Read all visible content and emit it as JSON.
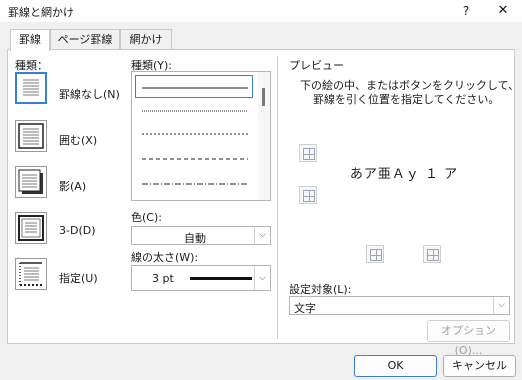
{
  "window": {
    "title": "罫線と網かけ",
    "help": "?",
    "close": "✕"
  },
  "tabs": [
    {
      "label": "罫線"
    },
    {
      "label": "ページ罫線"
    },
    {
      "label": "網かけ"
    }
  ],
  "settings": {
    "heading": "種類：",
    "items": [
      {
        "label": "罫線なし(N)"
      },
      {
        "label": "囲む(X)"
      },
      {
        "label": "影(A)"
      },
      {
        "label": "3-D(D)"
      },
      {
        "label": "指定(U)"
      }
    ]
  },
  "style": {
    "heading": "種類(Y):",
    "color_label": "色(C):",
    "color_value": "自動",
    "width_label": "線の太さ(W):",
    "width_value": "3 pt"
  },
  "preview": {
    "heading": "プレビュー",
    "instructions_1": "下の絵の中、またはボタンをクリックして、",
    "instructions_2": "罫線を引く位置を指定してください。",
    "sample_text": "あア亜Ａｙ １ ア"
  },
  "apply_to": {
    "label": "設定対象(L):",
    "value": "文字"
  },
  "buttons": {
    "options": "オプション(O)...",
    "ok": "OK",
    "cancel": "キャンセル"
  }
}
